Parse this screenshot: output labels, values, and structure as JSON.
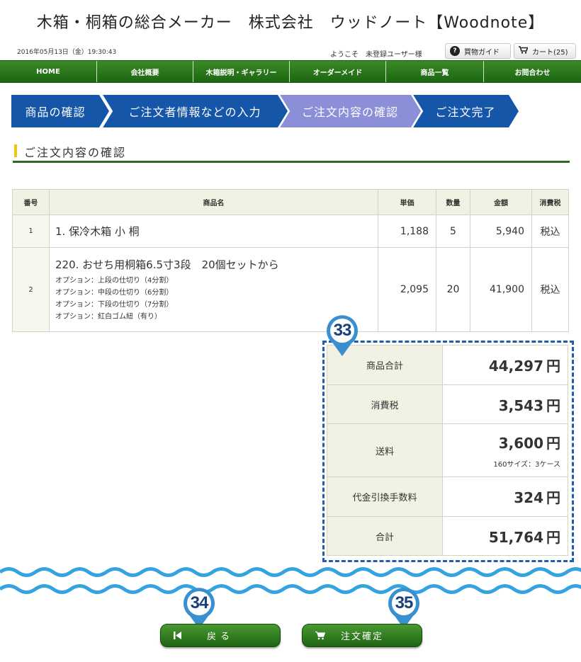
{
  "header": {
    "site_title": "木箱・桐箱の総合メーカー　株式会社　ウッドノート【Woodnote】",
    "datetime": "2016年05月13日（金）19:30:43",
    "welcome": "ようこそ　未登録ユーザー様",
    "guide_label": "買物ガイド",
    "cart_label": "カート(25)"
  },
  "nav": [
    {
      "label": "HOME"
    },
    {
      "label": "会社概要"
    },
    {
      "label": "木箱説明・ギャラリー"
    },
    {
      "label": "オーダーメイド"
    },
    {
      "label": "商品一覧"
    },
    {
      "label": "お問合わせ"
    }
  ],
  "steps": [
    {
      "label": "商品の確認",
      "active": false
    },
    {
      "label": "ご注文者情報などの入力",
      "active": false
    },
    {
      "label": "ご注文内容の確認",
      "active": true
    },
    {
      "label": "ご注文完了",
      "active": false
    }
  ],
  "section_title": "ご注文内容の確認",
  "table": {
    "headers": [
      "番号",
      "商品名",
      "単価",
      "数量",
      "金額",
      "消費税"
    ],
    "rows": [
      {
        "no": "1",
        "name": "1. 保冷木箱 小 桐",
        "options": [],
        "price": "1,188",
        "qty": "5",
        "amount": "5,940",
        "tax": "税込"
      },
      {
        "no": "2",
        "name": "220. おせち用桐箱6.5寸3段　20個セットから",
        "options": [
          "オプション：上段の仕切り（4分割）",
          "オプション：中段の仕切り（6分割）",
          "オプション：下段の仕切り（7分割）",
          "オプション：紅白ゴム紐（有り）"
        ],
        "price": "2,095",
        "qty": "20",
        "amount": "41,900",
        "tax": "税込"
      }
    ]
  },
  "totals": {
    "subtotal_label": "商品合計",
    "subtotal": "44,297",
    "tax_label": "消費税",
    "tax": "3,543",
    "shipping_label": "送料",
    "shipping": "3,600",
    "shipping_note": "160サイズ：3ケース",
    "cod_label": "代金引換手数料",
    "cod": "324",
    "total_label": "合計",
    "total": "51,764",
    "yen": "円"
  },
  "markers": {
    "m33": "33",
    "m34": "34",
    "m35": "35"
  },
  "buttons": {
    "back_label": "戻る",
    "confirm_label": "注文確定"
  },
  "colors": {
    "nav_green": "#2d7a1c",
    "step_blue": "#1556a8",
    "step_active": "#8a8fd8",
    "marker_blue": "#3a8fd0",
    "total_red": "#e0102a",
    "wave_blue": "#35a3e0"
  }
}
